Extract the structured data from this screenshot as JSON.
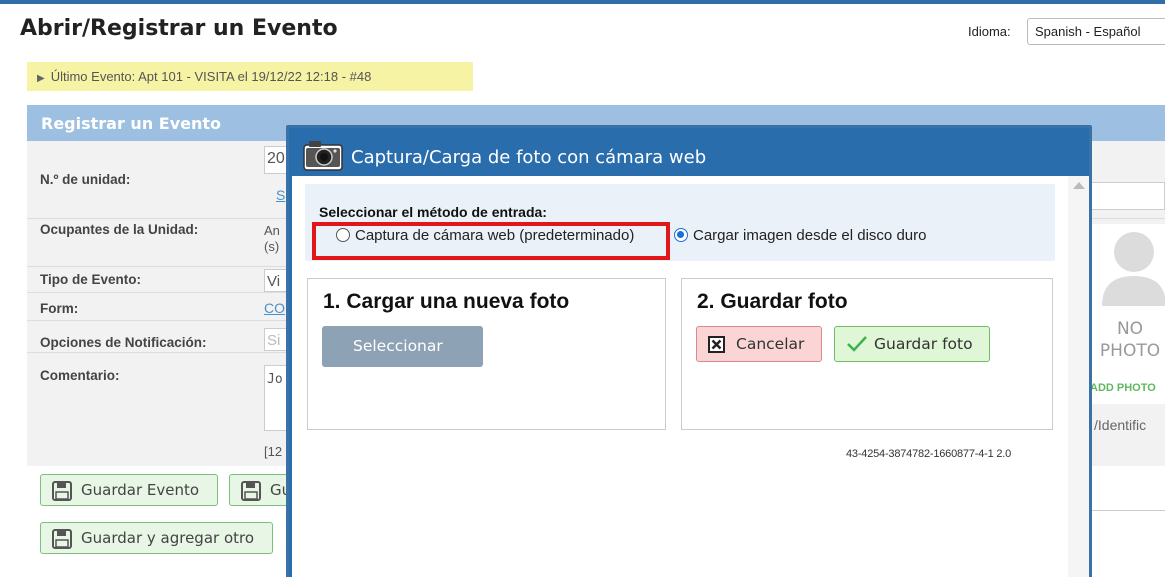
{
  "page": {
    "title": "Abrir/Registrar un Evento",
    "language_label": "Idioma:",
    "language_value": "Spanish - Español",
    "last_event": "Último Evento: Apt 101 - VISITA el 19/12/22 12:18 - #48"
  },
  "panel": {
    "header": "Registrar un Evento",
    "rows": [
      {
        "label": "N.º de unidad:",
        "value": "20",
        "link": "S"
      },
      {
        "label": "Ocupantes de la Unidad:",
        "value": "An",
        "value2": "(s)"
      },
      {
        "label": "Tipo de Evento:",
        "value": "Vi"
      },
      {
        "label": "Form:",
        "value": "CO"
      },
      {
        "label": "Opciones de Notificación:",
        "value": "Si"
      },
      {
        "label": "Comentario:",
        "value": "Jo",
        "stamp": "[12"
      }
    ],
    "buttons": {
      "save_event": "Guardar Evento",
      "save_other": "Gu",
      "save_add": "Guardar y agregar otro"
    },
    "right": {
      "no_photo": "NO",
      "photo": "PHOTO",
      "add_photo": "ADD PHOTO",
      "identif": "/Identific"
    }
  },
  "modal": {
    "title": "Captura/Carga de foto con cámara web",
    "method_title": "Seleccionar el método de entrada:",
    "option_webcam": "Captura de cámara web (predeterminado)",
    "option_disk": "Cargar imagen desde el disco duro",
    "selected_option": "disk",
    "step1_title": "1. Cargar una nueva foto",
    "step1_button": "Seleccionar",
    "step2_title": "2. Guardar foto",
    "cancel_button": "Cancelar",
    "save_button": "Guardar foto",
    "version": "43-4254-3874782-1660877-4-1 2.0"
  },
  "colors": {
    "modal_header": "#2a6dad",
    "panel_header": "#9dbfe1",
    "highlight": "#e0161b",
    "last_event_bg": "#f6f3a4"
  }
}
